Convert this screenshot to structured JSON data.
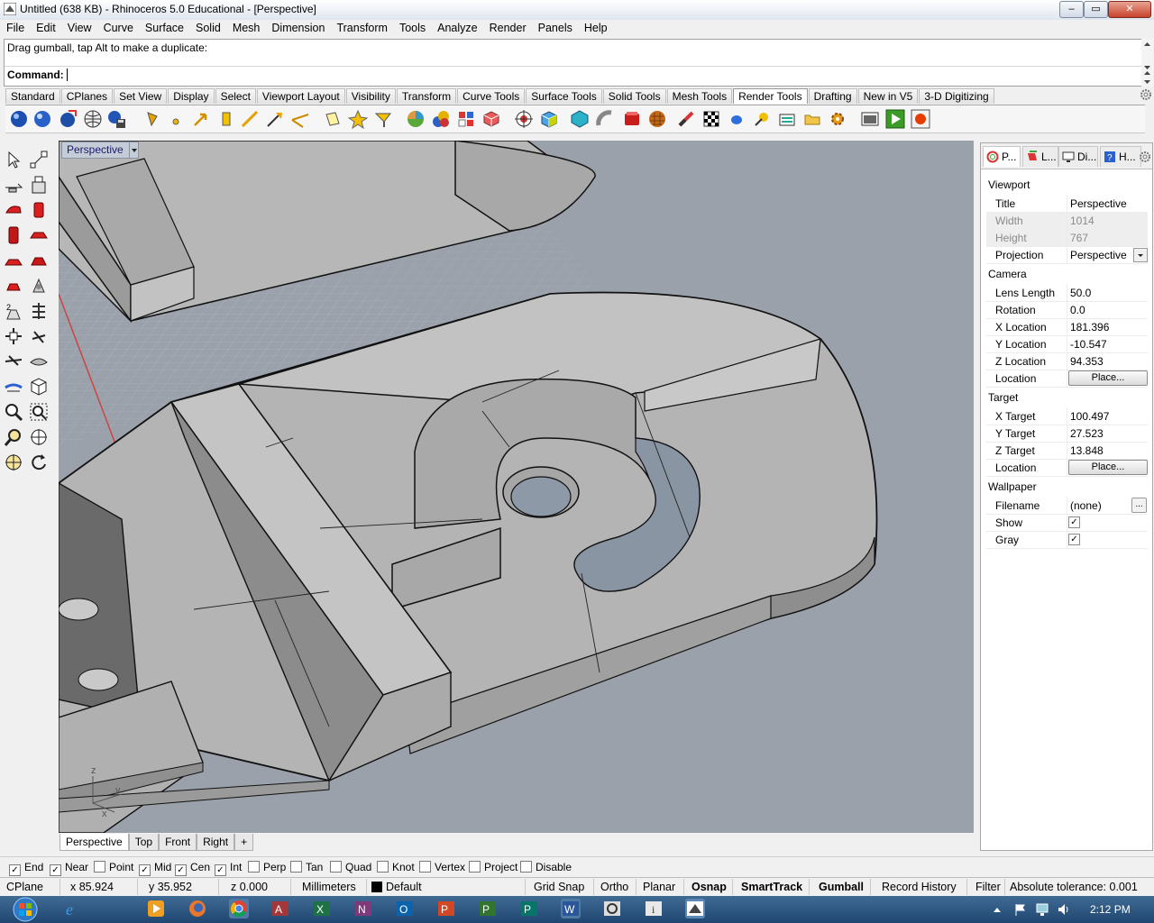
{
  "window": {
    "title": "Untitled (638 KB) - Rhinoceros 5.0 Educational - [Perspective]",
    "minimize": "–",
    "maximize": "▭",
    "close": "✕"
  },
  "menu": [
    "File",
    "Edit",
    "View",
    "Curve",
    "Surface",
    "Solid",
    "Mesh",
    "Dimension",
    "Transform",
    "Tools",
    "Analyze",
    "Render",
    "Panels",
    "Help"
  ],
  "command": {
    "history": "Drag gumball, tap Alt to make a duplicate:",
    "prompt": "Command:"
  },
  "toolbar_tabs": [
    "Standard",
    "CPlanes",
    "Set View",
    "Display",
    "Select",
    "Viewport Layout",
    "Visibility",
    "Transform",
    "Curve Tools",
    "Surface Tools",
    "Solid Tools",
    "Mesh Tools",
    "Render Tools",
    "Drafting",
    "New in V5",
    "3-D Digitizing"
  ],
  "active_toolbar_tab": "Render Tools",
  "viewport": {
    "title": "Perspective",
    "tabs": [
      "Perspective",
      "Top",
      "Front",
      "Right"
    ],
    "add_tab": "+"
  },
  "panel": {
    "tabs": [
      "P...",
      "L...",
      "Di...",
      "H..."
    ],
    "viewport_section": "Viewport",
    "viewport_rows": [
      {
        "key": "Title",
        "value": "Perspective"
      },
      {
        "key": "Width",
        "value": "1014"
      },
      {
        "key": "Height",
        "value": "767"
      },
      {
        "key": "Projection",
        "value": "Perspective"
      }
    ],
    "camera_section": "Camera",
    "camera_rows": [
      {
        "key": "Lens Length",
        "value": "50.0"
      },
      {
        "key": "Rotation",
        "value": "0.0"
      },
      {
        "key": "X Location",
        "value": "181.396"
      },
      {
        "key": "Y Location",
        "value": "-10.547"
      },
      {
        "key": "Z Location",
        "value": "94.353"
      },
      {
        "key": "Location",
        "value": "Place..."
      }
    ],
    "target_section": "Target",
    "target_rows": [
      {
        "key": "X Target",
        "value": "100.497"
      },
      {
        "key": "Y Target",
        "value": "27.523"
      },
      {
        "key": "Z Target",
        "value": "13.848"
      },
      {
        "key": "Location",
        "value": "Place..."
      }
    ],
    "wallpaper_section": "Wallpaper",
    "wallpaper_rows": [
      {
        "key": "Filename",
        "value": "(none)",
        "button": "..."
      },
      {
        "key": "Show",
        "value": "✓"
      },
      {
        "key": "Gray",
        "value": "✓"
      }
    ]
  },
  "osnaps": [
    {
      "label": "End",
      "checked": "✓"
    },
    {
      "label": "Near",
      "checked": "✓"
    },
    {
      "label": "Point",
      "checked": ""
    },
    {
      "label": "Mid",
      "checked": "✓"
    },
    {
      "label": "Cen",
      "checked": "✓"
    },
    {
      "label": "Int",
      "checked": "✓"
    },
    {
      "label": "Perp",
      "checked": ""
    },
    {
      "label": "Tan",
      "checked": ""
    },
    {
      "label": "Quad",
      "checked": ""
    },
    {
      "label": "Knot",
      "checked": ""
    },
    {
      "label": "Vertex",
      "checked": ""
    },
    {
      "label": "Project",
      "checked": ""
    },
    {
      "label": "Disable",
      "checked": ""
    }
  ],
  "status": {
    "cplane": "CPlane",
    "x": "x 85.924",
    "y": "y 35.952",
    "z": "z 0.000",
    "units": "Millimeters",
    "layer": "Default",
    "grid_snap": "Grid Snap",
    "ortho": "Ortho",
    "planar": "Planar",
    "osnap": "Osnap",
    "smarttrack": "SmartTrack",
    "gumball": "Gumball",
    "record_history": "Record History",
    "filter": "Filter",
    "tolerance": "Absolute tolerance: 0.001"
  },
  "axes": {
    "x": "x",
    "y": "y",
    "z": "z"
  },
  "taskbar": {
    "clock": "2:12 PM",
    "apps": [
      "windows-start",
      "internet-explorer",
      "media-player",
      "firefox",
      "chrome",
      "access",
      "excel",
      "onenote",
      "outlook",
      "powerpoint",
      "project",
      "publisher",
      "word",
      "rhino"
    ]
  },
  "colors": {
    "viewport_bg": "#9aa1ab",
    "model_surface": "#b8b8b8",
    "grid_line": "#a9b0b9",
    "taskbar": "#2a557f"
  }
}
